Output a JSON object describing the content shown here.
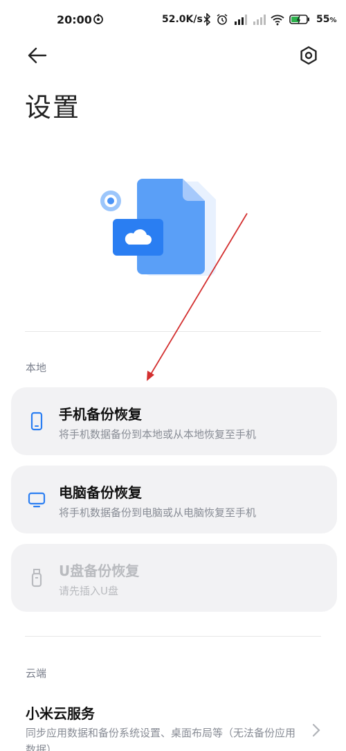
{
  "status_bar": {
    "time": "20:00",
    "net_speed": "52.0K/s",
    "battery_percent": "55",
    "battery_unit": "%"
  },
  "header": {
    "back_icon": "arrow-left-icon",
    "settings_icon": "hexagon-gear-icon",
    "title": "设置"
  },
  "sections": {
    "local_label": "本地",
    "cloud_label": "云端"
  },
  "local_items": [
    {
      "title": "手机备份恢复",
      "desc": "将手机数据备份到本地或从本地恢复至手机",
      "icon": "phone-icon",
      "enabled": true
    },
    {
      "title": "电脑备份恢复",
      "desc": "将手机数据备份到电脑或从电脑恢复至手机",
      "icon": "monitor-icon",
      "enabled": true
    },
    {
      "title": "U盘备份恢复",
      "desc": "请先插入U盘",
      "icon": "usb-drive-icon",
      "enabled": false
    }
  ],
  "cloud_item": {
    "title": "小米云服务",
    "desc": "同步应用数据和备份系统设置、桌面布局等（无法备份应用数据）"
  },
  "colors": {
    "accent_blue": "#3d8af7",
    "card_bg": "#f2f2f4",
    "annotation_arrow": "#d32f2f"
  }
}
